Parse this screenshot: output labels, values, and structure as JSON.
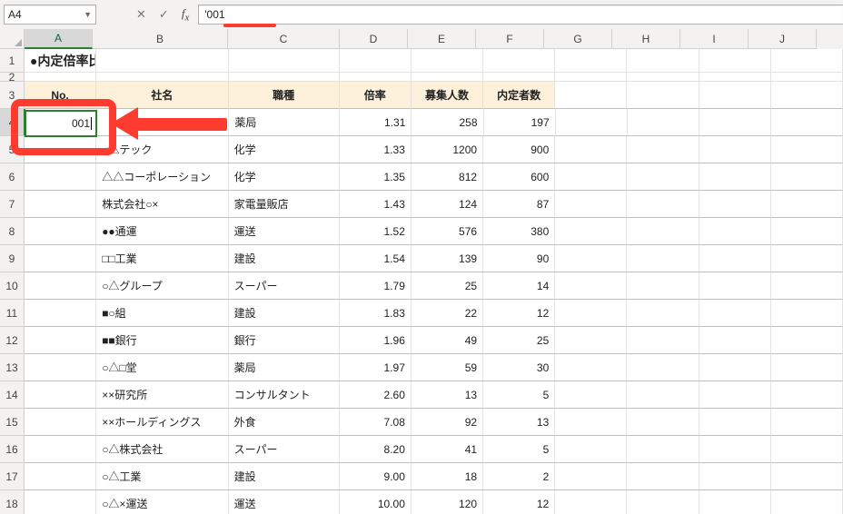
{
  "formula_bar": {
    "namebox": "A4",
    "formula": "'001"
  },
  "columns": [
    "A",
    "B",
    "C",
    "D",
    "E",
    "F",
    "G",
    "H",
    "I",
    "J"
  ],
  "row_headers": [
    "1",
    "2",
    "3",
    "4",
    "5",
    "6",
    "7",
    "8",
    "9",
    "10",
    "11",
    "12",
    "13",
    "14",
    "15",
    "16",
    "17",
    "18"
  ],
  "title": "●内定倍率比較",
  "headers": {
    "no": "No.",
    "company": "社名",
    "type": "職種",
    "rate": "倍率",
    "apply": "募集人数",
    "decided": "内定者数"
  },
  "active_cell_value": "001",
  "rows": [
    {
      "company": "",
      "type": "薬局",
      "rate": "1.31",
      "apply": "258",
      "decided": "197"
    },
    {
      "company": "○△テック",
      "type": "化学",
      "rate": "1.33",
      "apply": "1200",
      "decided": "900"
    },
    {
      "company": "△△コーポレーション",
      "type": "化学",
      "rate": "1.35",
      "apply": "812",
      "decided": "600"
    },
    {
      "company": "株式会社○×",
      "type": "家電量販店",
      "rate": "1.43",
      "apply": "124",
      "decided": "87"
    },
    {
      "company": "●●通運",
      "type": "運送",
      "rate": "1.52",
      "apply": "576",
      "decided": "380"
    },
    {
      "company": "□□工業",
      "type": "建設",
      "rate": "1.54",
      "apply": "139",
      "decided": "90"
    },
    {
      "company": "○△グループ",
      "type": "スーパー",
      "rate": "1.79",
      "apply": "25",
      "decided": "14"
    },
    {
      "company": "■○組",
      "type": "建設",
      "rate": "1.83",
      "apply": "22",
      "decided": "12"
    },
    {
      "company": "■■銀行",
      "type": "銀行",
      "rate": "1.96",
      "apply": "49",
      "decided": "25"
    },
    {
      "company": "○△□堂",
      "type": "薬局",
      "rate": "1.97",
      "apply": "59",
      "decided": "30"
    },
    {
      "company": "××研究所",
      "type": "コンサルタント",
      "rate": "2.60",
      "apply": "13",
      "decided": "5"
    },
    {
      "company": "××ホールディングス",
      "type": "外食",
      "rate": "7.08",
      "apply": "92",
      "decided": "13"
    },
    {
      "company": "○△株式会社",
      "type": "スーパー",
      "rate": "8.20",
      "apply": "41",
      "decided": "5"
    },
    {
      "company": "○△工業",
      "type": "建設",
      "rate": "9.00",
      "apply": "18",
      "decided": "2"
    },
    {
      "company": "○△×運送",
      "type": "運送",
      "rate": "10.00",
      "apply": "120",
      "decided": "12"
    }
  ]
}
